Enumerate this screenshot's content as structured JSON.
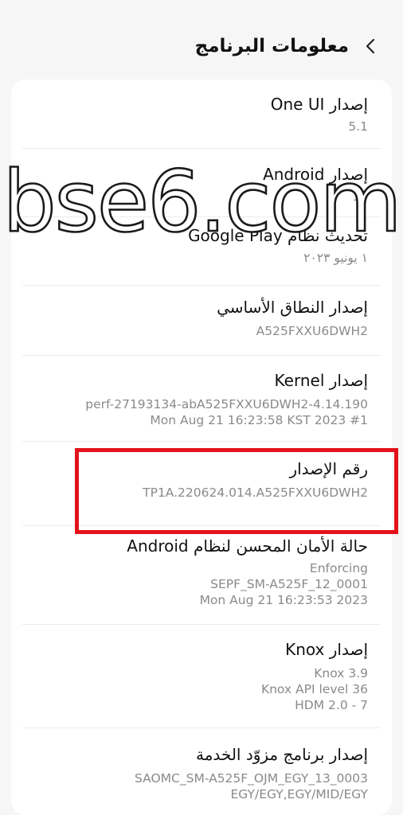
{
  "header": {
    "title": "معلومات البرنامج",
    "back_icon": "chevron-left-icon"
  },
  "items": [
    {
      "title": "إصدار One UI",
      "values": [
        "5.1"
      ]
    },
    {
      "title": "إصدار Android",
      "values": [
        "13"
      ]
    },
    {
      "title": "تحديث نظام Google Play",
      "values": [
        "١ يونيو ٢٠٢٣"
      ]
    },
    {
      "title": "إصدار النطاق الأساسي",
      "values": [
        "A525FXXU6DWH2"
      ]
    },
    {
      "title": "إصدار Kernel",
      "values": [
        "4.14.190-perf-27193134-abA525FXXU6DWH2",
        "#1 Mon Aug 21 16:23:58 KST 2023"
      ]
    },
    {
      "title": "رقم الإصدار",
      "values": [
        "TP1A.220624.014.A525FXXU6DWH2"
      ]
    },
    {
      "title": "حالة الأمان المحسن لنظام Android",
      "values": [
        "Enforcing",
        "SEPF_SM-A525F_12_0001",
        "Mon Aug 21 16:23:53 2023"
      ]
    },
    {
      "title": "إصدار Knox",
      "values": [
        "Knox 3.9",
        "Knox API level 36",
        "HDM 2.0 - 7"
      ]
    },
    {
      "title": "إصدار برنامج مزوّد الخدمة",
      "values": [
        "SAOMC_SM-A525F_OJM_EGY_13_0003",
        "EGY/EGY,EGY/MID/EGY"
      ]
    }
  ],
  "watermark": {
    "text": "bse6.com"
  },
  "highlight": {
    "color": "#e3121b",
    "target": "رقم الإصدار"
  }
}
